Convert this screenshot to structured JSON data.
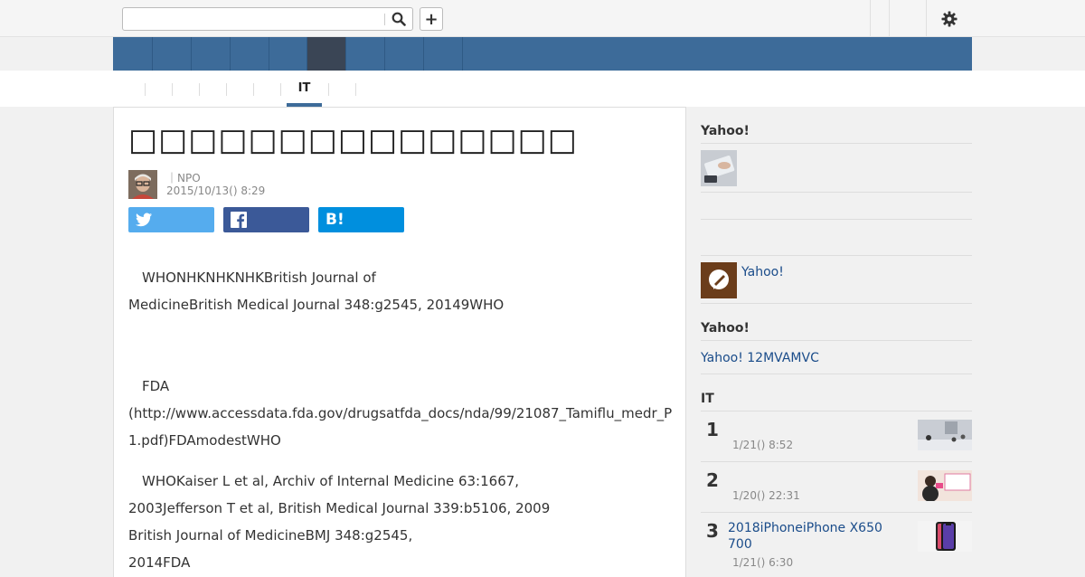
{
  "topbar": {
    "search_placeholder": "",
    "search_icon": "search-icon",
    "add_label": "+",
    "settings_icon": "gear-icon"
  },
  "nav": {
    "active_index": 5,
    "items": [
      "",
      "",
      "",
      "",
      "",
      "",
      "",
      "",
      ""
    ]
  },
  "subnav": {
    "items": [
      "",
      "",
      "",
      "",
      "",
      "",
      "IT",
      ""
    ],
    "active": "IT"
  },
  "article": {
    "title": "□□□□□□□□□□□□□□□",
    "author": "｜NPO",
    "date": "2015/10/13() 8:29",
    "share": {
      "twitter_icon": "twitter-icon",
      "facebook_icon": "facebook-icon",
      "hatena_label": "B!"
    },
    "paragraphs": [
      [
        "　WHONHKNHKNHKBritish Journal of",
        "MedicineBritish Medical Journal 348:g2545, 20149WHO"
      ],
      [
        "　FDA",
        "(http://www.accessdata.fda.gov/drugsatfda_docs/nda/99/21087_Tamiflu_medr_P",
        "1.pdf)FDAmodestWHO"
      ],
      [
        "　WHOKaiser L et al, Archiv of Internal Medicine 63:1667,",
        "2003Jefferson T et al, British Medical Journal 339:b5106, 2009",
        "British Journal of MedicineBMJ 348:g2545,",
        "2014FDA"
      ]
    ]
  },
  "sidebar": {
    "section1_heading": "Yahoo!",
    "section2_link": "Yahoo!",
    "section3_heading": "Yahoo!",
    "section3_link": "Yahoo! 12MVAMVC",
    "ranking_heading": "IT",
    "ranking": [
      {
        "rank": "1",
        "title": "",
        "date": "1/21() 8:52"
      },
      {
        "rank": "2",
        "title": "",
        "date": "1/20() 22:31"
      },
      {
        "rank": "3",
        "title": "2018iPhoneiPhone X650 700",
        "date": "1/21() 6:30"
      }
    ]
  },
  "colors": {
    "nav_blue": "#3d6b99",
    "nav_active": "#3a4555",
    "link": "#1a4c8a",
    "twitter": "#55acee",
    "facebook": "#3b5998",
    "hatena": "#008fde"
  }
}
